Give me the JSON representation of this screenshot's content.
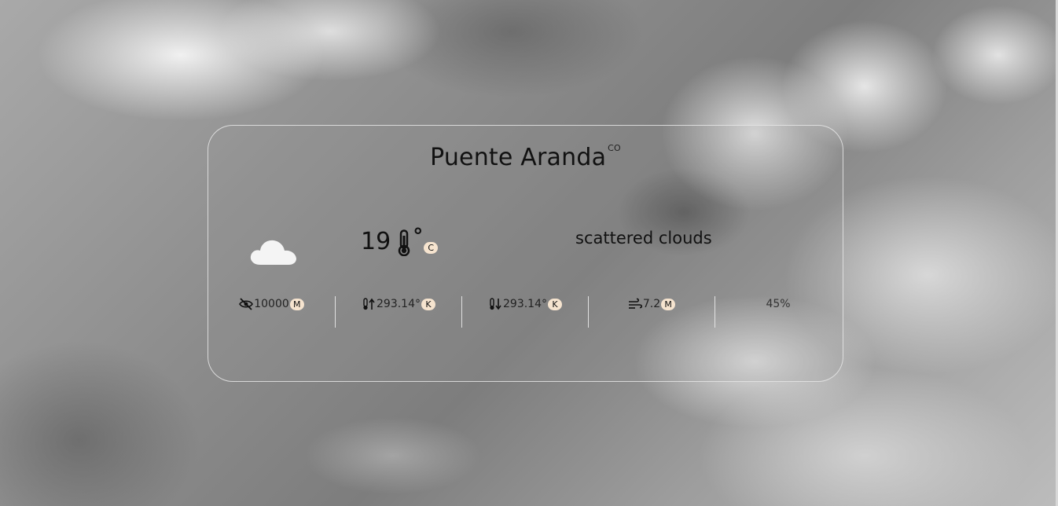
{
  "location": {
    "city": "Puente Aranda",
    "country": "CO"
  },
  "current": {
    "temperature": "19",
    "degree_symbol": "°",
    "unit": "C",
    "description": "scattered clouds",
    "icon": "cloud-icon"
  },
  "stats": {
    "visibility": {
      "icon": "eye-slash-icon",
      "value": "10000",
      "unit": "M"
    },
    "temp_max": {
      "icon": "thermometer-up-icon",
      "value": "293.14°",
      "unit": "K"
    },
    "temp_min": {
      "icon": "thermometer-down-icon",
      "value": "293.14°",
      "unit": "K"
    },
    "wind": {
      "icon": "wind-icon",
      "value": "7.2",
      "unit": "M"
    },
    "humidity": {
      "value": "45%"
    }
  },
  "colors": {
    "badge": "#f6e4cf",
    "text": "#111111",
    "card_border": "#e6e6e6"
  }
}
